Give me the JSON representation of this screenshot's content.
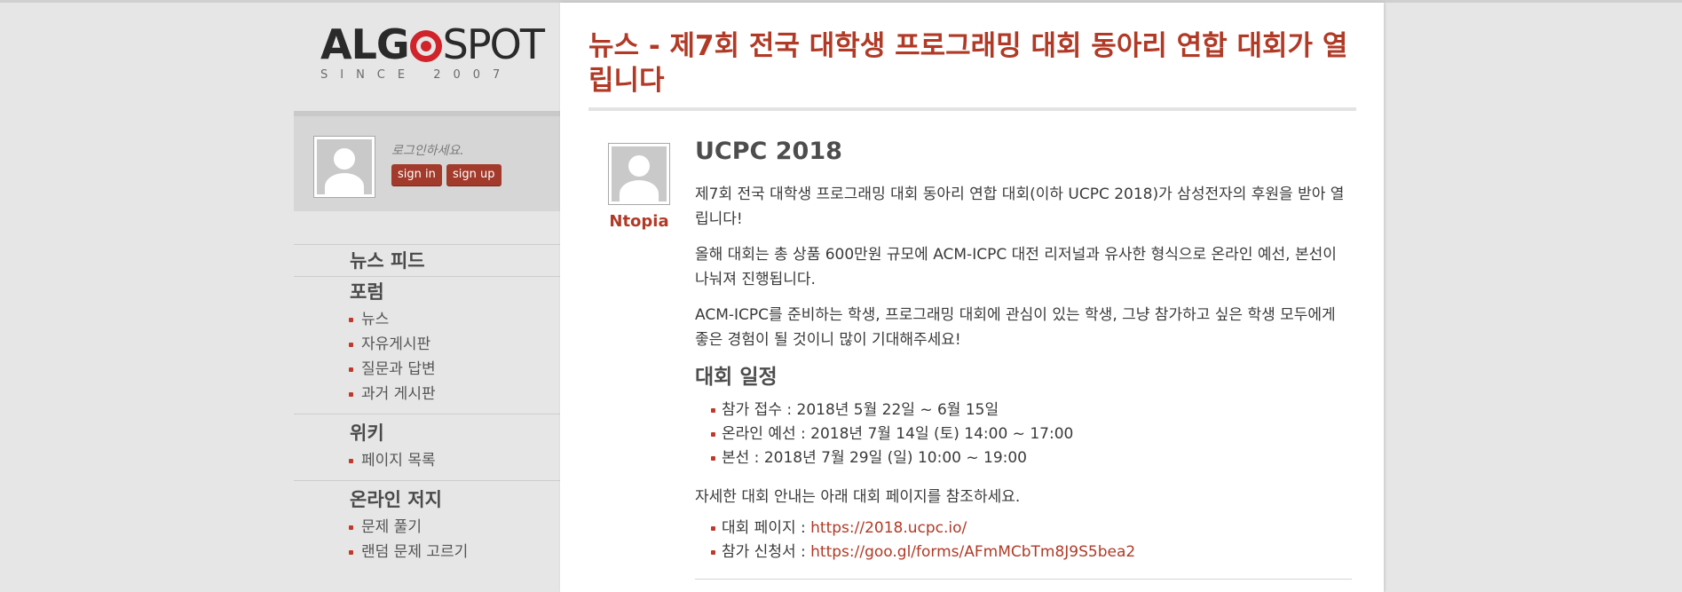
{
  "logo": {
    "text_bold": "ALG",
    "text_light": "SPOT",
    "since": "SINCE 2007"
  },
  "login": {
    "prompt": "로그인하세요.",
    "sign_in": "sign in",
    "sign_up": "sign up"
  },
  "nav": {
    "news_feed": "뉴스 피드",
    "forum": {
      "title": "포럼",
      "items": [
        "뉴스",
        "자유게시판",
        "질문과 답변",
        "과거 게시판"
      ]
    },
    "wiki": {
      "title": "위키",
      "items": [
        "페이지 목록"
      ]
    },
    "judge": {
      "title": "온라인 저지",
      "items": [
        "문제 풀기",
        "랜덤 문제 고르기"
      ]
    }
  },
  "post": {
    "title": "뉴스 - 제7회 전국 대학생 프로그래밍 대회 동아리 연합 대회가 열립니다",
    "author": "Ntopia",
    "heading": "UCPC 2018",
    "paragraphs": [
      "제7회 전국 대학생 프로그래밍 대회 동아리 연합 대회(이하 UCPC 2018)가 삼성전자의 후원을 받아 열립니다!",
      "올해 대회는 총 상품 600만원 규모에 ACM-ICPC 대전 리저널과 유사한 형식으로 온라인 예선, 본선이 나눠져 진행됩니다.",
      "ACM-ICPC를 준비하는 학생, 프로그래밍 대회에 관심이 있는 학생, 그냥 참가하고 싶은 학생 모두에게 좋은 경험이 될 것이니 많이 기대해주세요!"
    ],
    "schedule_heading": "대회 일정",
    "schedule": [
      "참가 접수 : 2018년 5월 22일 ~ 6월 15일",
      "온라인 예선 : 2018년 7월 14일 (토) 14:00 ~ 17:00",
      "본선 : 2018년 7월 29일 (일) 10:00 ~ 19:00"
    ],
    "info_text": "자세한 대회 안내는 아래 대회 페이지를 참조하세요.",
    "links": [
      {
        "label": "대회 페이지 : ",
        "url": "https://2018.ucpc.io/"
      },
      {
        "label": "참가 신청서 : ",
        "url": "https://goo.gl/forms/AFmMCbTm8J9S5bea2"
      }
    ]
  },
  "colors": {
    "accent": "#b13a26",
    "button": "#a23b2c",
    "page_bg": "#e6e6e6",
    "bullet": "#c0392b"
  }
}
